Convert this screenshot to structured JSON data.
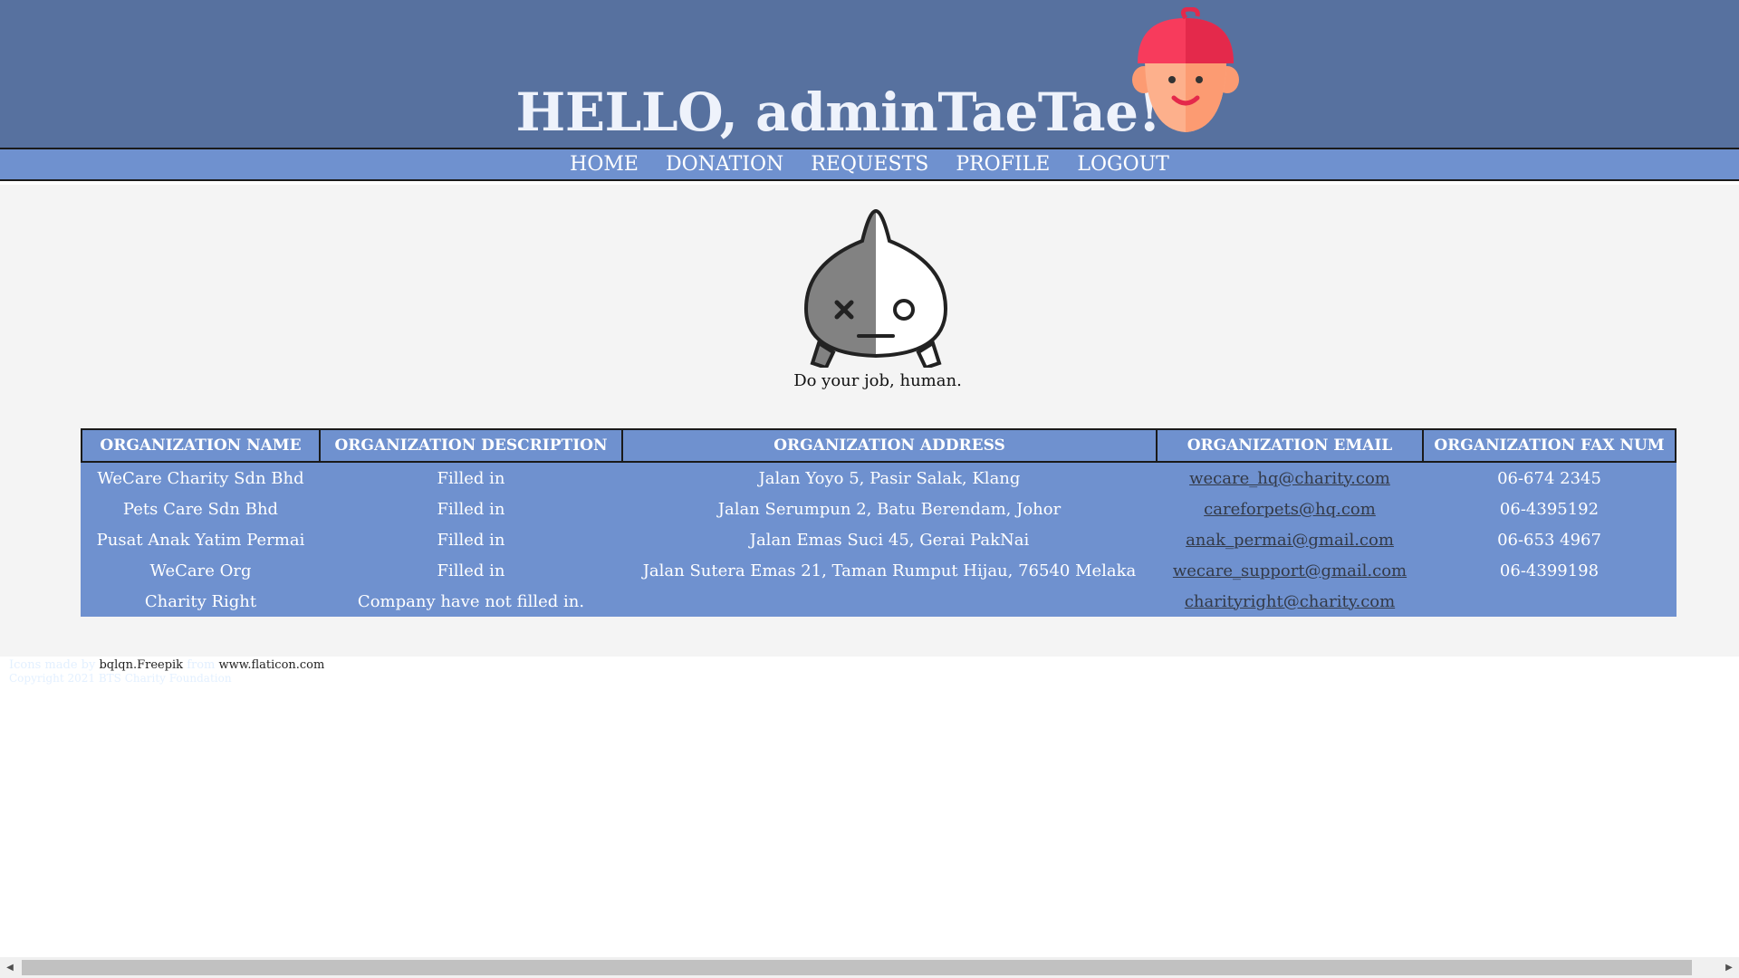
{
  "header": {
    "greeting": "HELLO, adminTaeTae!",
    "avatar_icon": "boy-avatar-icon"
  },
  "nav": {
    "items": [
      {
        "label": "HOME"
      },
      {
        "label": "DONATION"
      },
      {
        "label": "REQUESTS"
      },
      {
        "label": "PROFILE"
      },
      {
        "label": "LOGOUT"
      }
    ]
  },
  "main": {
    "mascot_icon": "mascot-character-icon",
    "tagline": "Do your job, human."
  },
  "table": {
    "columns": [
      "ORGANIZATION NAME",
      "ORGANIZATION DESCRIPTION",
      "ORGANIZATION ADDRESS",
      "ORGANIZATION EMAIL",
      "ORGANIZATION FAX NUM"
    ],
    "rows": [
      {
        "name": "WeCare Charity Sdn Bhd",
        "description": "Filled in",
        "address": "Jalan Yoyo 5, Pasir Salak, Klang",
        "email": "wecare_hq@charity.com",
        "fax": "06-674 2345"
      },
      {
        "name": "Pets Care Sdn Bhd",
        "description": "Filled in",
        "address": "Jalan Serumpun 2, Batu Berendam, Johor",
        "email": "careforpets@hq.com",
        "fax": "06-4395192"
      },
      {
        "name": "Pusat Anak Yatim Permai",
        "description": "Filled in",
        "address": "Jalan Emas Suci 45, Gerai PakNai",
        "email": "anak_permai@gmail.com",
        "fax": "06-653 4967"
      },
      {
        "name": "WeCare Org",
        "description": "Filled in",
        "address": "Jalan Sutera Emas 21, Taman Rumput Hijau, 76540 Melaka",
        "email": "wecare_support@gmail.com",
        "fax": "06-4399198"
      },
      {
        "name": "Charity Right",
        "description": "Company have not filled in.",
        "address": "",
        "email": "charityright@charity.com",
        "fax": ""
      }
    ]
  },
  "footer": {
    "credit_prefix": "Icons made by ",
    "credit_author": "bqlqn.Freepik",
    "credit_from": " from ",
    "credit_site": "www.flaticon.com",
    "copyright": "Copyright 2021 BTS Charity Foundation"
  },
  "colors": {
    "header_bg": "#57719f",
    "nav_bg": "#6f91cf",
    "table_bg": "#6f91cf",
    "page_bg": "#f4f4f4"
  }
}
